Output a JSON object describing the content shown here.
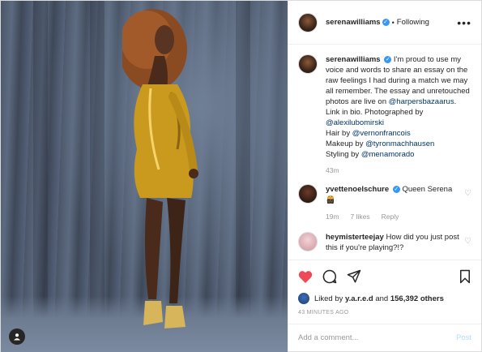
{
  "post": {
    "username": "serenawilliams",
    "separator": "•",
    "follow_status": "Following",
    "more_icon": "more-horizontal-icon"
  },
  "caption": {
    "username": "serenawilliams",
    "text_1": "I'm proud to use my voice and words to share an essay on the raw feelings I had during a match we may all remember. The essay and unretouched photos are live on ",
    "mention_1": "@harpersbazaarus",
    "text_2": ". Link in bio. Photographed by ",
    "mention_2": "@alexilubomirski",
    "text_3": "Hair by ",
    "mention_3": "@vernonfrancois",
    "text_4": "Makeup by ",
    "mention_4": "@tyronmachhausen",
    "text_5": "Styling by ",
    "mention_5": "@menamorado",
    "time": "43m"
  },
  "comments": [
    {
      "username": "yvettenoelschure",
      "text": "Queen Serena 👸🏿",
      "time": "19m",
      "likes": "7 likes",
      "reply": "Reply"
    },
    {
      "username": "heymisterteejay",
      "text": "How did you just post this if you're playing?!?"
    }
  ],
  "actions": {
    "like_icon": "heart-filled-icon",
    "comment_icon": "comment-icon",
    "share_icon": "share-icon",
    "save_icon": "bookmark-icon",
    "like_color": "#ed4956"
  },
  "likes": {
    "prefix": "Liked by",
    "user": "y.a.r.e.d",
    "conjunction": "and",
    "count": "156,392 others"
  },
  "timestamp": "43 MINUTES AGO",
  "add_comment": {
    "placeholder": "Add a comment...",
    "post_label": "Post"
  }
}
